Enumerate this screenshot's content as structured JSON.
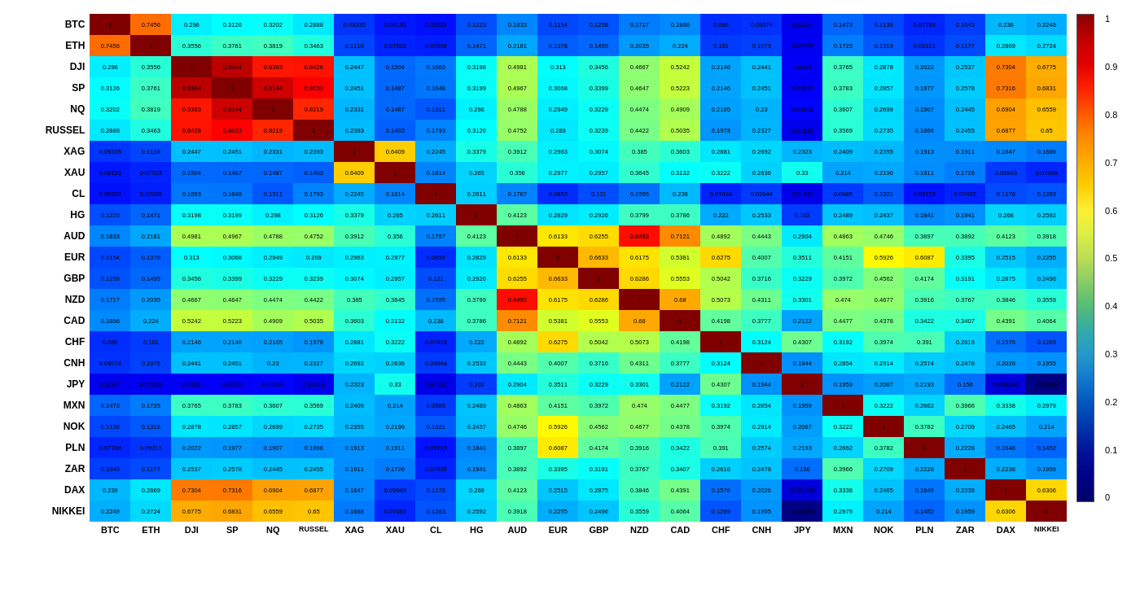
{
  "labels": [
    "BTC",
    "ETH",
    "DJI",
    "SP",
    "NQ",
    "RUSSEL",
    "XAG",
    "XAU",
    "CL",
    "HG",
    "AUD",
    "EUR",
    "GBP",
    "NZD",
    "CAD",
    "CHF",
    "CNH",
    "JPY",
    "MXN",
    "NOK",
    "PLN",
    "ZAR",
    "DAX",
    "NIKKEI"
  ],
  "colorbar": {
    "ticks": [
      "1",
      "0.9",
      "0.8",
      "0.7",
      "0.6",
      "0.5",
      "0.4",
      "0.3",
      "0.2",
      "0.1",
      "0"
    ]
  },
  "matrix": [
    [
      1,
      0.7456,
      0.296,
      0.3126,
      0.3202,
      0.2888,
      0.09335,
      0.06193,
      0.05522,
      0.1223,
      0.1833,
      0.1154,
      0.1258,
      0.1717,
      0.1866,
      0.086,
      0.09074,
      0.02147,
      0.1473,
      0.1136,
      0.07788,
      0.1043,
      0.236,
      0.2249
    ],
    [
      0.7456,
      1,
      0.3556,
      0.3761,
      0.3819,
      0.3463,
      0.1118,
      0.07503,
      0.07038,
      0.1471,
      0.2181,
      0.1378,
      0.1495,
      0.2035,
      0.224,
      0.101,
      0.1075,
      0.02359,
      0.1725,
      0.1319,
      0.09211,
      0.1177,
      0.2869,
      0.2724
    ],
    [
      0.296,
      0.3556,
      1,
      0.9344,
      0.8383,
      0.8428,
      0.2447,
      0.1504,
      0.1663,
      0.3198,
      0.4981,
      0.313,
      0.3456,
      0.4667,
      0.5242,
      0.2146,
      0.2441,
      0.0305,
      0.3765,
      0.2878,
      0.2022,
      0.2537,
      0.7304,
      0.6775
    ],
    [
      0.3126,
      0.3761,
      0.9344,
      1,
      0.9144,
      0.8633,
      0.2451,
      0.1487,
      0.1648,
      0.3199,
      0.4967,
      0.3068,
      0.3399,
      0.4647,
      0.5223,
      0.2146,
      0.2451,
      0.03263,
      0.3783,
      0.2857,
      0.1977,
      0.2578,
      0.7316,
      0.6831
    ],
    [
      0.3202,
      0.3819,
      0.8383,
      0.9144,
      1,
      0.8219,
      0.2331,
      0.1487,
      0.1311,
      0.298,
      0.4788,
      0.2949,
      0.3229,
      0.4474,
      0.4909,
      0.2105,
      0.23,
      0.04202,
      0.3607,
      0.2699,
      0.1907,
      0.2445,
      0.6904,
      0.6559
    ],
    [
      0.2888,
      0.3463,
      0.8428,
      0.8633,
      0.8219,
      1,
      0.2393,
      0.1403,
      0.1793,
      0.3126,
      0.4752,
      0.289,
      0.3239,
      0.4422,
      0.5035,
      0.1978,
      0.2327,
      0.01816,
      0.3569,
      0.2735,
      0.1866,
      0.2455,
      0.6877,
      0.65
    ],
    [
      0.09335,
      0.1118,
      0.2447,
      0.2451,
      0.2331,
      0.2393,
      1,
      0.6409,
      0.2245,
      0.3379,
      0.3912,
      0.2963,
      0.3074,
      0.385,
      0.3603,
      0.2881,
      0.2692,
      0.2323,
      0.2409,
      0.2355,
      0.1913,
      0.1911,
      0.1847,
      0.1688
    ],
    [
      0.06193,
      0.07503,
      0.1504,
      0.1487,
      0.1487,
      0.1403,
      0.6409,
      1,
      0.1814,
      0.265,
      0.356,
      0.2977,
      0.2957,
      0.3645,
      0.3132,
      0.3222,
      0.2636,
      0.33,
      0.214,
      0.2196,
      0.1911,
      0.1726,
      0.09943,
      0.07869
    ],
    [
      0.05522,
      0.07038,
      0.1663,
      0.1648,
      0.1311,
      0.1793,
      0.2245,
      0.1814,
      1,
      0.2611,
      0.1787,
      0.0853,
      0.121,
      0.1595,
      0.238,
      0.07418,
      0.09944,
      0.01431,
      0.0985,
      0.1321,
      0.05715,
      0.07435,
      0.1176,
      0.1283
    ],
    [
      0.1223,
      0.1471,
      0.3198,
      0.3199,
      0.298,
      0.3126,
      0.3379,
      0.265,
      0.2611,
      1,
      0.4123,
      0.2829,
      0.2926,
      0.3799,
      0.3786,
      0.222,
      0.2533,
      0.102,
      0.2489,
      0.2437,
      0.1841,
      0.1941,
      0.268,
      0.2592
    ],
    [
      0.1833,
      0.2181,
      0.4981,
      0.4967,
      0.4788,
      0.4752,
      0.3912,
      0.356,
      0.1787,
      0.4123,
      1,
      0.6133,
      0.6255,
      0.8493,
      0.7121,
      0.4892,
      0.4443,
      0.2904,
      0.4863,
      0.4746,
      0.3897,
      0.3892,
      0.4123,
      0.3918
    ],
    [
      0.1154,
      0.1378,
      0.313,
      0.3068,
      0.2949,
      0.289,
      0.2963,
      0.2977,
      0.0853,
      0.2829,
      0.6133,
      1,
      0.6633,
      0.6175,
      0.5381,
      0.6275,
      0.4007,
      0.3511,
      0.4151,
      0.5926,
      0.6087,
      0.3395,
      0.2515,
      0.2255
    ],
    [
      0.1258,
      0.1495,
      0.3456,
      0.3399,
      0.3229,
      0.3239,
      0.3074,
      0.2957,
      0.121,
      0.2926,
      0.6255,
      0.6633,
      1,
      0.6286,
      0.5553,
      0.5042,
      0.3716,
      0.3229,
      0.3972,
      0.4562,
      0.4174,
      0.3191,
      0.2875,
      0.2496
    ],
    [
      0.1717,
      0.2035,
      0.4667,
      0.4647,
      0.4474,
      0.4422,
      0.385,
      0.3645,
      0.1595,
      0.3799,
      0.8493,
      0.6175,
      0.6286,
      1,
      0.68,
      0.5073,
      0.4311,
      0.3301,
      0.474,
      0.4677,
      0.3916,
      0.3767,
      0.3846,
      0.3559
    ],
    [
      0.1866,
      0.224,
      0.5242,
      0.5223,
      0.4909,
      0.5035,
      0.3603,
      0.3132,
      0.238,
      0.3786,
      0.7121,
      0.5381,
      0.5553,
      0.68,
      1,
      0.4198,
      0.3777,
      0.2122,
      0.4477,
      0.4378,
      0.3422,
      0.3407,
      0.4391,
      0.4064
    ],
    [
      0.086,
      0.101,
      0.2146,
      0.2146,
      0.2105,
      0.1978,
      0.2881,
      0.3222,
      0.07418,
      0.222,
      0.4892,
      0.6275,
      0.5042,
      0.5073,
      0.4198,
      1,
      0.3124,
      0.4307,
      0.3192,
      0.3974,
      0.391,
      0.2616,
      0.1576,
      0.1269
    ],
    [
      0.09074,
      0.1075,
      0.2441,
      0.2451,
      0.23,
      0.2327,
      0.2692,
      0.2636,
      0.09944,
      0.2533,
      0.4443,
      0.4007,
      0.3716,
      0.4311,
      0.3777,
      0.3124,
      1,
      0.1944,
      0.2854,
      0.2914,
      0.2574,
      0.2478,
      0.2026,
      0.1955
    ],
    [
      0.02147,
      0.02359,
      0.0305,
      0.03263,
      0.04202,
      0.01816,
      0.2323,
      0.33,
      0.01431,
      0.102,
      0.2904,
      0.3511,
      0.3229,
      0.3301,
      0.2122,
      0.4307,
      0.1944,
      1,
      0.1959,
      0.2087,
      0.2193,
      0.156,
      0.001266,
      -0.09502
    ],
    [
      0.1473,
      0.1725,
      0.3765,
      0.3783,
      0.3607,
      0.3569,
      0.2409,
      0.214,
      0.0985,
      0.2489,
      0.4863,
      0.4151,
      0.3972,
      0.474,
      0.4477,
      0.3192,
      0.2854,
      0.1959,
      1,
      0.3222,
      0.2662,
      0.3966,
      0.3338,
      0.2979
    ],
    [
      0.1136,
      0.1319,
      0.2878,
      0.2857,
      0.2699,
      0.2735,
      0.2355,
      0.2196,
      0.1321,
      0.2437,
      0.4746,
      0.5926,
      0.4562,
      0.4677,
      0.4378,
      0.3974,
      0.2914,
      0.2087,
      0.3222,
      1,
      0.3782,
      0.2709,
      0.2465,
      0.214
    ],
    [
      0.07788,
      0.09211,
      0.2022,
      0.1977,
      0.1907,
      0.1866,
      0.1913,
      0.1911,
      0.05715,
      0.1841,
      0.3897,
      0.6087,
      0.4174,
      0.3916,
      0.3422,
      0.391,
      0.2574,
      0.2193,
      0.2662,
      0.3782,
      1,
      0.2228,
      0.1646,
      0.1452
    ],
    [
      0.1043,
      0.1177,
      0.2537,
      0.2578,
      0.2445,
      0.2455,
      0.1911,
      0.1726,
      0.07435,
      0.1941,
      0.3892,
      0.3395,
      0.3191,
      0.3767,
      0.3407,
      0.2616,
      0.2478,
      0.156,
      0.3966,
      0.2709,
      0.2228,
      1,
      0.2238,
      0.1959
    ],
    [
      0.236,
      0.2869,
      0.7304,
      0.7316,
      0.6904,
      0.6877,
      0.1847,
      0.09943,
      0.1176,
      0.268,
      0.4123,
      0.2515,
      0.2875,
      0.3846,
      0.4391,
      0.1576,
      0.2026,
      0.001266,
      0.3338,
      0.2465,
      0.1646,
      0.2238,
      1,
      0.6306
    ],
    [
      0.2249,
      0.2724,
      0.6775,
      0.6831,
      0.6559,
      0.65,
      0.1688,
      0.07869,
      0.1283,
      0.2592,
      0.3918,
      0.2255,
      0.2496,
      0.3559,
      0.4064,
      0.1269,
      0.1955,
      -0.09502,
      0.2979,
      0.214,
      0.1452,
      0.1959,
      0.6306,
      1
    ]
  ]
}
